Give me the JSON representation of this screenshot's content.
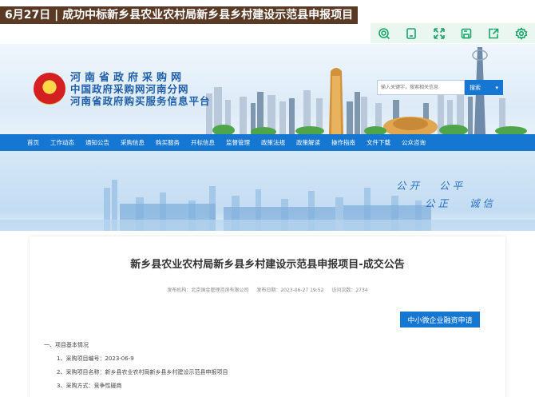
{
  "headline": "6月27日 | 成功中标新乡县农业农村局新乡县乡村建设示范县申报项目",
  "toolbar": {
    "icons": [
      "search-icon",
      "copy-icon",
      "expand-icon",
      "save-icon",
      "share-icon",
      "settings-icon"
    ]
  },
  "header": {
    "site_name_1": "河南省政府采购网",
    "site_name_2": "中国政府采购网河南分网",
    "site_name_3": "河南省政府购买服务信息平台",
    "search_placeholder": "输入关键字，搜索相关信息",
    "search_button": "搜索"
  },
  "nav": {
    "items": [
      "首页",
      "工作动态",
      "通知公告",
      "采购信息",
      "购买服务",
      "开标信息",
      "监督管理",
      "政策法规",
      "政策解读",
      "操作指南",
      "文件下载",
      "公众咨询"
    ]
  },
  "slogans": {
    "gongkai": "公开",
    "gongping": "公平",
    "gongzheng": "公正",
    "chengxin": "诚信"
  },
  "article": {
    "title": "新乡县农业农村局新乡县乡村建设示范县申报项目-成交公告",
    "publisher": "发布机构：北京国金管理咨询有限公司",
    "date": "发布日期：2023-06-27 19:52",
    "views": "访问次数：2734",
    "finance_button": "中小微企业融资申请",
    "section_title": "一、项目基本情况",
    "items": [
      "1、采购项目编号：2023-06-9",
      "2、采购项目名称：新乡县农业农村局新乡县乡村建设示范县申报项目",
      "3、采购方式：竞争性磋商"
    ]
  },
  "colors": {
    "nav_blue": "#1677d2",
    "headline_bg": "#5a3a24",
    "toolbar_green": "#1aa56b"
  }
}
